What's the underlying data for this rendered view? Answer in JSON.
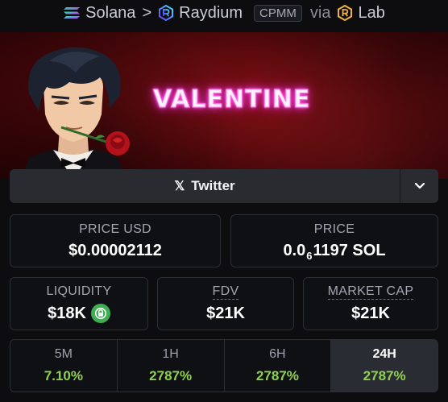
{
  "breadcrumb": {
    "chain": "Solana",
    "separator": ">",
    "dex": "Raydium",
    "pool_type": "CPMM",
    "via_text": "via",
    "launchpad": "Lab"
  },
  "banner": {
    "title": "VALENTINE"
  },
  "socials": {
    "twitter_label": "Twitter"
  },
  "stats": {
    "price_usd": {
      "label": "PRICE USD",
      "value": "$0.00002112"
    },
    "price": {
      "label": "PRICE",
      "value_prefix": "0.0",
      "value_sub": "6",
      "value_suffix": "1197 SOL"
    },
    "liquidity": {
      "label": "LIQUIDITY",
      "value": "$18K"
    },
    "fdv": {
      "label": "FDV",
      "value": "$21K"
    },
    "market_cap": {
      "label": "MARKET CAP",
      "value": "$21K"
    }
  },
  "changes": [
    {
      "label": "5M",
      "value": "7.10%"
    },
    {
      "label": "1H",
      "value": "2787%"
    },
    {
      "label": "6H",
      "value": "2787%"
    },
    {
      "label": "24H",
      "value": "2787%",
      "active": true
    }
  ],
  "colors": {
    "positive": "#8fd14f",
    "lock_green": "#3fae52",
    "banner_red": "#5c0a0d",
    "neon_pink": "#ff3ad6"
  },
  "icons": {
    "chain": "solana-icon",
    "dex": "raydium-icon",
    "launchpad": "lab-icon",
    "twitter": "x-icon",
    "dropdown": "chevron-down-icon",
    "liquidity_lock": "lock-icon"
  }
}
